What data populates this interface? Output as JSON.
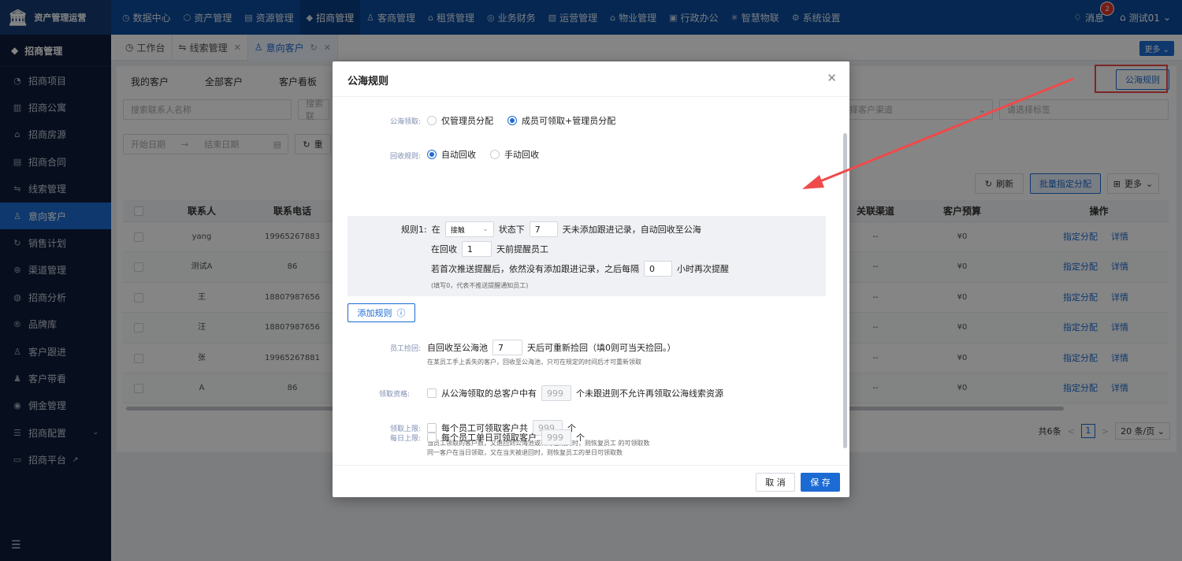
{
  "app": {
    "logo_text": "资产管理运营"
  },
  "topnav": [
    {
      "icon": "dashboard-icon",
      "label": "数据中心"
    },
    {
      "icon": "cube-icon",
      "label": "资产管理"
    },
    {
      "icon": "building-icon",
      "label": "资源管理"
    },
    {
      "icon": "tag-icon",
      "label": "招商管理"
    },
    {
      "icon": "users-icon",
      "label": "客商管理"
    },
    {
      "icon": "home-icon",
      "label": "租赁管理"
    },
    {
      "icon": "money-icon",
      "label": "业务财务"
    },
    {
      "icon": "chart-icon",
      "label": "运营管理"
    },
    {
      "icon": "property-icon",
      "label": "物业管理"
    },
    {
      "icon": "office-icon",
      "label": "行政办公"
    },
    {
      "icon": "iot-icon",
      "label": "智慧物联"
    },
    {
      "icon": "settings-icon",
      "label": "系统设置"
    }
  ],
  "topright": {
    "message_label": "消息",
    "message_count": "2",
    "user": "测试01"
  },
  "sidebar": {
    "header": "招商管理",
    "items": [
      {
        "label": "招商项目"
      },
      {
        "label": "招商公寓"
      },
      {
        "label": "招商房源"
      },
      {
        "label": "招商合同"
      },
      {
        "label": "线索管理"
      },
      {
        "label": "意向客户"
      },
      {
        "label": "销售计划"
      },
      {
        "label": "渠道管理"
      },
      {
        "label": "招商分析"
      },
      {
        "label": "品牌库"
      },
      {
        "label": "客户跟进"
      },
      {
        "label": "客户带看"
      },
      {
        "label": "佣金管理"
      },
      {
        "label": "招商配置"
      },
      {
        "label": "招商平台"
      }
    ]
  },
  "tabs": [
    {
      "label": "工作台"
    },
    {
      "label": "线索管理"
    },
    {
      "label": "意向客户"
    }
  ],
  "tabstrip_more": "更多",
  "main": {
    "subtabs": [
      "我的客户",
      "全部客户",
      "客户看板"
    ],
    "rules_button": "公海规则",
    "search_contact_placeholder": "搜索联系人名称",
    "search_phone_placeholder": "搜索联",
    "channel_placeholder": "择客户渠道",
    "tag_placeholder": "请选择标签",
    "start_date": "开始日期",
    "end_date": "结束日期",
    "reset_label": "重",
    "refresh_label": "刷新",
    "batch_assign_label": "批量指定分配",
    "more_label": "更多",
    "table": {
      "headers": {
        "contact": "联系人",
        "phone": "联系电话",
        "channel": "关联渠道",
        "budget": "客户预算",
        "actions": "操作"
      },
      "rows": [
        {
          "contact": "yang",
          "phone": "19965267883",
          "channel": "--",
          "budget": "¥0"
        },
        {
          "contact": "测试A",
          "phone": "86",
          "channel": "--",
          "budget": "¥0"
        },
        {
          "contact": "王",
          "phone": "18807987656",
          "channel": "--",
          "budget": "¥0"
        },
        {
          "contact": "汪",
          "phone": "18807987656",
          "channel": "--",
          "budget": "¥0"
        },
        {
          "contact": "张",
          "phone": "19965267881",
          "channel": "--",
          "budget": "¥0"
        },
        {
          "contact": "A",
          "phone": "86",
          "channel": "--",
          "budget": "¥0"
        }
      ],
      "assign_label": "指定分配",
      "detail_label": "详情"
    },
    "pager": {
      "total": "共6条",
      "page": "1",
      "page_size": "20 条/页"
    }
  },
  "modal": {
    "title": "公海规则",
    "pool_claim": {
      "label": "公海领取:",
      "option1": "仅管理员分配",
      "option2": "成员可领取+管理员分配",
      "selected": 2
    },
    "recycle": {
      "label": "回收规则:",
      "option1": "自动回收",
      "option2": "手动回收",
      "selected": 1
    },
    "rule1": {
      "prefix": "规则1:",
      "in_label": "在",
      "status_value": "接触",
      "status_suffix": "状态下",
      "days": "7",
      "days_suffix": "天未添加跟进记录，自动回收至公海",
      "remind_prefix": "在回收",
      "remind_days": "1",
      "remind_suffix": "天前提醒员工",
      "repeat_prefix": "若首次推送提醒后，依然没有添加跟进记录，之后每隔",
      "repeat_hours": "0",
      "repeat_suffix": "小时再次提醒",
      "note": "(填写0，代表不推送提醒通知员工)"
    },
    "add_rule_label": "添加规则",
    "employee_reclaim": {
      "label": "员工捡回:",
      "prefix": "自回收至公海池",
      "days": "7",
      "suffix": "天后可重新捡回（填0则可当天捡回。）",
      "note": "在某员工手上丢失的客户，回收至公海池，只可在规定的时间后才可重新领取"
    },
    "claim_qualification": {
      "label": "领取资格:",
      "prefix": "从公海领取的总客户中有",
      "value": "999",
      "suffix": "个未跟进则不允许再领取公海线索资源"
    },
    "claim_limit": {
      "label": "领取上限:",
      "prefix": "每个员工可领取客户共",
      "value": "999",
      "suffix": "个",
      "note": "当员工领取的客户数，又退回到公海池或转为已成交时，则恢复员工 的可领取数"
    },
    "daily_limit": {
      "label": "每日上限:",
      "prefix": "每个员工单日可领取客户",
      "value": "999",
      "suffix": "个",
      "note": "同一客户在当日领取，又在当天被退回时，则恢复员工的单日可领取数"
    },
    "cancel_label": "取 消",
    "save_label": "保 存"
  },
  "colors": {
    "primary": "#1c6bd4",
    "topbar": "#0b4b9c",
    "sidebar": "#0f1c3a",
    "annotation": "#f04a4a"
  }
}
